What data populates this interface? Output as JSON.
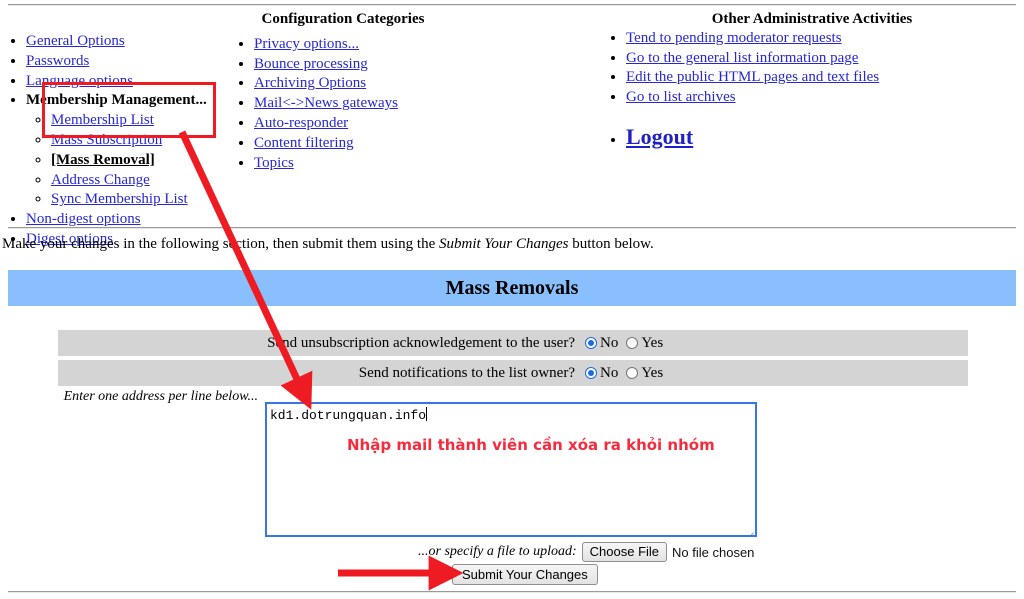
{
  "nav": {
    "general_items": [
      {
        "label": "General Options",
        "type": "link"
      },
      {
        "label": "Passwords",
        "type": "link"
      },
      {
        "label": "Language options",
        "type": "link"
      },
      {
        "label": "Membership Management...",
        "type": "bold"
      },
      {
        "label": "Non-digest options",
        "type": "link"
      },
      {
        "label": "Digest options",
        "type": "link"
      }
    ],
    "membership_subitems": [
      {
        "label": "Membership List",
        "type": "link"
      },
      {
        "label": "Mass Subscription",
        "type": "link"
      },
      {
        "label": "[Mass Removal]",
        "type": "current"
      },
      {
        "label": "Address Change",
        "type": "link"
      },
      {
        "label": "Sync Membership List",
        "type": "link"
      }
    ],
    "config_heading": "Configuration Categories",
    "config_items": [
      {
        "label": "Privacy options..."
      },
      {
        "label": "Bounce processing"
      },
      {
        "label": "Archiving Options"
      },
      {
        "label": "Mail<->News gateways"
      },
      {
        "label": "Auto-responder"
      },
      {
        "label": "Content filtering"
      },
      {
        "label": "Topics"
      }
    ],
    "other_heading": "Other Administrative Activities",
    "other_items": [
      {
        "label": "Tend to pending moderator requests"
      },
      {
        "label": "Go to the general list information page"
      },
      {
        "label": "Edit the public HTML pages and text files"
      },
      {
        "label": "Go to list archives"
      }
    ],
    "logout_label": "Logout"
  },
  "instruction": {
    "before": "Make your changes in the following section, then submit them using the ",
    "emphasis": "Submit Your Changes",
    "after": " button below."
  },
  "banner": {
    "title": "Mass Removals",
    "color": "#88bffc"
  },
  "options": [
    {
      "label": "Send unsubscription acknowledgement to the user?",
      "choices": [
        {
          "label": "No",
          "selected": true
        },
        {
          "label": "Yes",
          "selected": false
        }
      ]
    },
    {
      "label": "Send notifications to the list owner?",
      "choices": [
        {
          "label": "No",
          "selected": true
        },
        {
          "label": "Yes",
          "selected": false
        }
      ]
    }
  ],
  "address_entry": {
    "label": "Enter one address per line below...",
    "textarea_value": "kd1.dotrungquan.info",
    "annotation_note": "Nhập mail thành viên cần xóa ra khỏi nhóm",
    "annotation_color": "#f42c3e"
  },
  "upload": {
    "label": "...or specify a file to upload:",
    "choose_file_label": "Choose File",
    "no_file_label": "No file chosen"
  },
  "submit": {
    "label": "Submit Your Changes"
  },
  "annotations": {
    "highlight_color": "#ee1c22",
    "arrow_color": "#ee1c22"
  }
}
